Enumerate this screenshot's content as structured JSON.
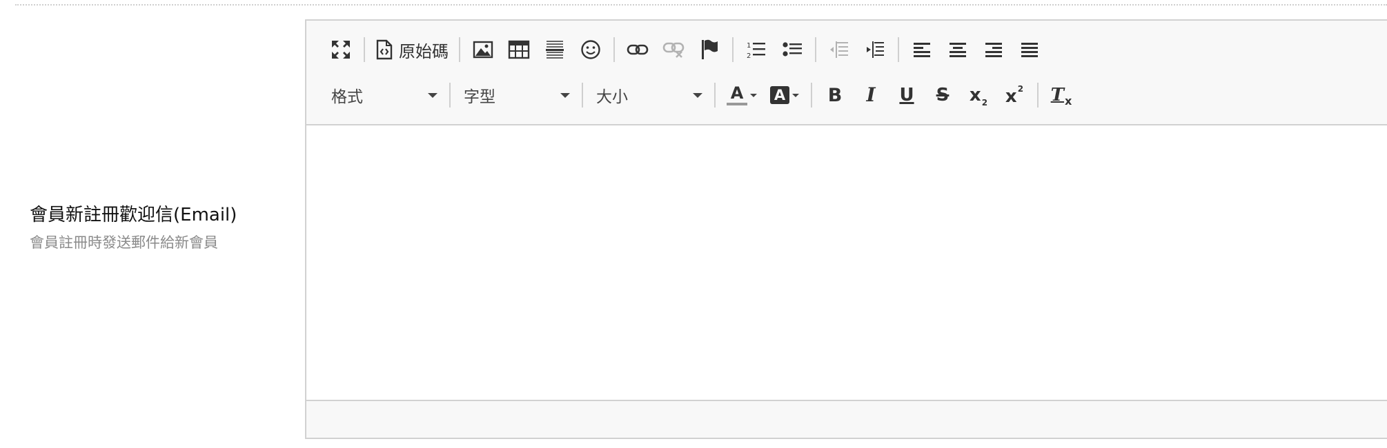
{
  "field": {
    "title": "會員新註冊歡迎信(Email)",
    "description": "會員註冊時發送郵件給新會員"
  },
  "toolbar": {
    "maximize_icon": "maximize-icon",
    "source_label": "原始碼",
    "source_icon": "source-code-icon",
    "image_icon": "image-icon",
    "table_icon": "table-icon",
    "horizontal_line_icon": "horizontal-line-icon",
    "smiley_icon": "smiley-icon",
    "link_icon": "link-icon",
    "unlink_icon": "unlink-icon",
    "anchor_icon": "flag-icon",
    "numbered_list_icon": "numbered-list-icon",
    "bulleted_list_icon": "bulleted-list-icon",
    "outdent_icon": "outdent-icon",
    "indent_icon": "indent-icon",
    "align_left_icon": "align-left-icon",
    "align_center_icon": "align-center-icon",
    "align_right_icon": "align-right-icon",
    "justify_icon": "align-justify-icon",
    "format_label": "格式",
    "font_label": "字型",
    "size_label": "大小",
    "text_color_glyph": "A",
    "bg_color_glyph": "A",
    "bold_glyph": "B",
    "italic_glyph": "I",
    "underline_glyph": "U",
    "strike_glyph": "S",
    "subscript_glyph": "x",
    "subscript_mark": "2",
    "superscript_glyph": "x",
    "superscript_mark": "2",
    "remove_format_glyph": "T",
    "remove_format_mark": "x"
  },
  "colors": {
    "toolbar_bg": "#f8f8f8",
    "border": "#d1d1d1",
    "icon": "#333333",
    "text_color_bar": "#999999"
  }
}
